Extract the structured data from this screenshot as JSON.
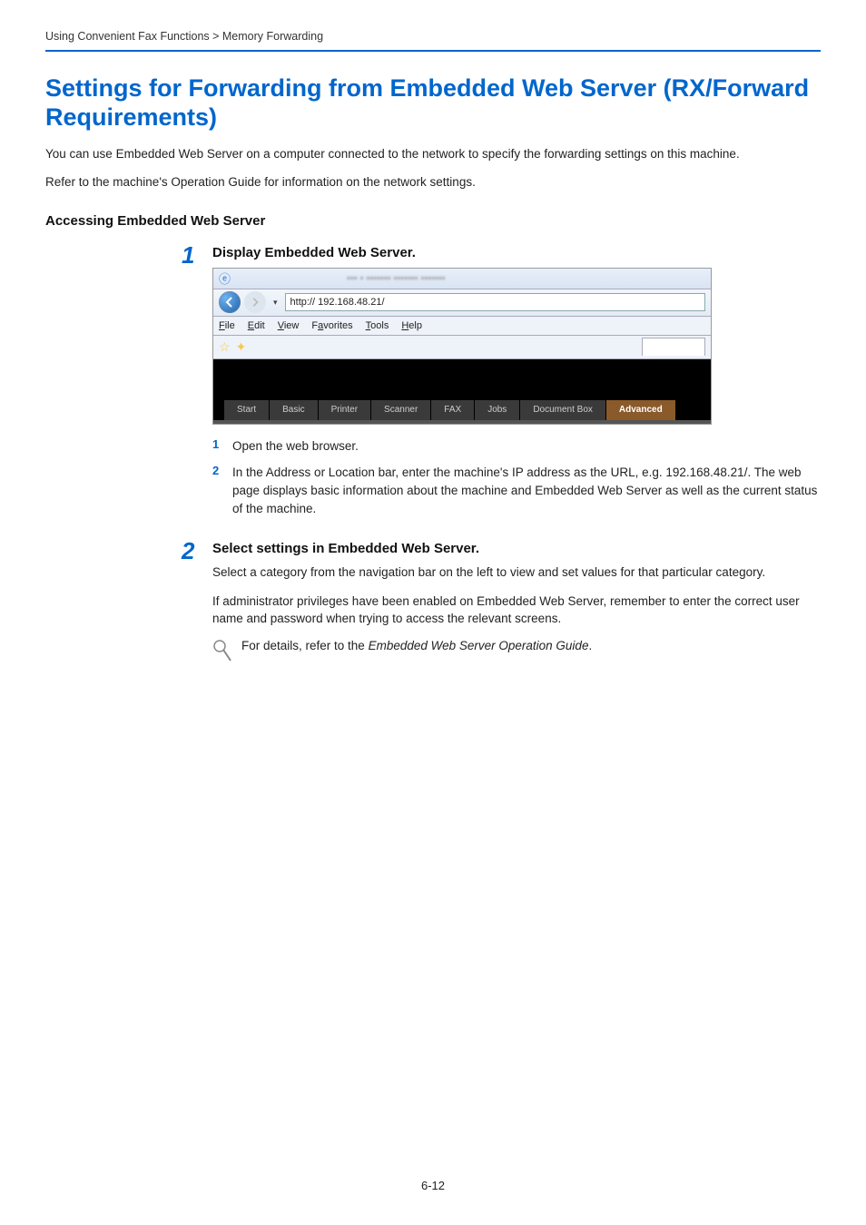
{
  "breadcrumb": "Using Convenient Fax Functions > Memory Forwarding",
  "title": "Settings for Forwarding from Embedded Web Server (RX/Forward Requirements)",
  "intro1": "You can use Embedded Web Server on a computer connected to the network to specify the forwarding settings on this machine.",
  "intro2": "Refer to the machine's Operation Guide for information on the network settings.",
  "sectionHeading": "Accessing Embedded Web Server",
  "step1": {
    "num": "1",
    "title": "Display Embedded Web Server.",
    "browser": {
      "url": "http:// 192.168.48.21/",
      "menu": {
        "file": "File",
        "edit": "Edit",
        "view": "View",
        "favorites": "Favorites",
        "tools": "Tools",
        "help": "Help"
      },
      "tabs": [
        "Start",
        "Basic",
        "Printer",
        "Scanner",
        "FAX",
        "Jobs",
        "Document Box",
        "Advanced"
      ]
    },
    "sub1": {
      "num": "1",
      "text": "Open the web browser."
    },
    "sub2": {
      "num": "2",
      "text": "In the Address or Location bar, enter the machine's IP address as the URL, e.g. 192.168.48.21/. The web page displays basic information about the machine and Embedded Web Server as well as the current status of the machine."
    }
  },
  "step2": {
    "num": "2",
    "title": "Select settings in Embedded Web Server.",
    "para1": "Select a category from the navigation bar on the left to view and set values for that particular category.",
    "para2": "If administrator privileges have been enabled on Embedded Web Server, remember to enter the correct user name and password when trying to access the relevant screens.",
    "note_prefix": "For details, refer to the ",
    "note_em": "Embedded Web Server Operation Guide",
    "note_suffix": "."
  },
  "pageNum": "6-12"
}
